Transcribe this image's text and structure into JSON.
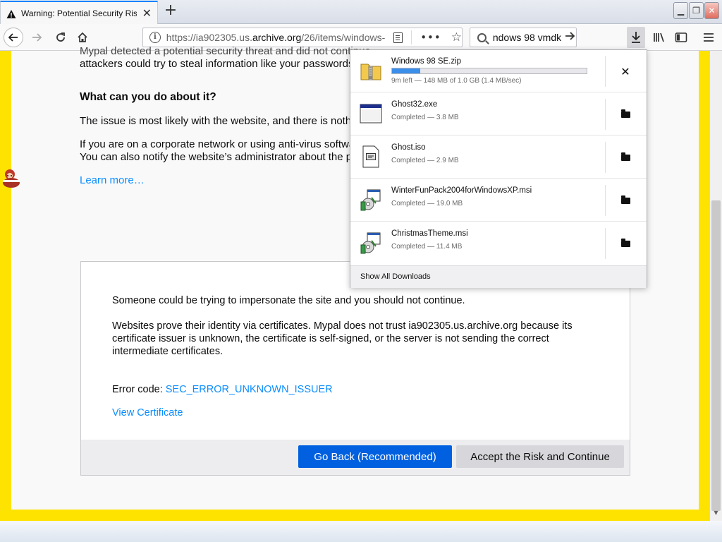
{
  "tab": {
    "title": "Warning: Potential Security Risk Ahead"
  },
  "urlbar": {
    "url_prefix": "https://ia902305.us.",
    "url_domain": "archive.org",
    "url_path": "/26/items/windows-"
  },
  "searchbar": {
    "value": "ndows 98 vmdk"
  },
  "page": {
    "intro_line1": "Mypal detected a potential security threat and did not continue",
    "intro_line2": "attackers could try to steal information like your passwords,",
    "heading": "What can you do about it?",
    "issue_text": "The issue is most likely with the website, and there is nothing",
    "corporate_line1": "If you are on a corporate network or using anti-virus software",
    "corporate_line2": "You can also notify the website’s administrator about the p",
    "learn_more": "Learn more…"
  },
  "advanced": {
    "impersonate": "Someone could be trying to impersonate the site and you should not continue.",
    "certs_para": "Websites prove their identity via certificates. Mypal does not trust ia902305.us.archive.org because its certificate issuer is unknown, the certificate is self-signed, or the server is not sending the correct intermediate certificates.",
    "error_label": "Error code: ",
    "error_code": "SEC_ERROR_UNKNOWN_ISSUER",
    "view_certificate": "View Certificate",
    "go_back": "Go Back (Recommended)",
    "accept_risk": "Accept the Risk and Continue"
  },
  "downloads": {
    "items": [
      {
        "name": "Windows 98 SE.zip",
        "status": "9m left — 148 MB of 1.0 GB (1.4 MB/sec)",
        "progress": 0.145,
        "icon": "zip-archive-icon"
      },
      {
        "name": "Ghost32.exe",
        "status": "Completed — 3.8 MB",
        "icon": "exe-window-icon"
      },
      {
        "name": "Ghost.iso",
        "status": "Completed — 2.9 MB",
        "icon": "disc-image-icon"
      },
      {
        "name": "WinterFunPack2004forWindowsXP.msi",
        "status": "Completed — 19.0 MB",
        "icon": "installer-package-icon"
      },
      {
        "name": "ChristmasTheme.msi",
        "status": "Completed — 11.4 MB",
        "icon": "installer-package-icon"
      }
    ],
    "show_all": "Show All Downloads"
  },
  "colors": {
    "accent": "#0060df",
    "link": "#0a8dff",
    "frame": "#ffe300",
    "progress": "#3b8eea"
  }
}
